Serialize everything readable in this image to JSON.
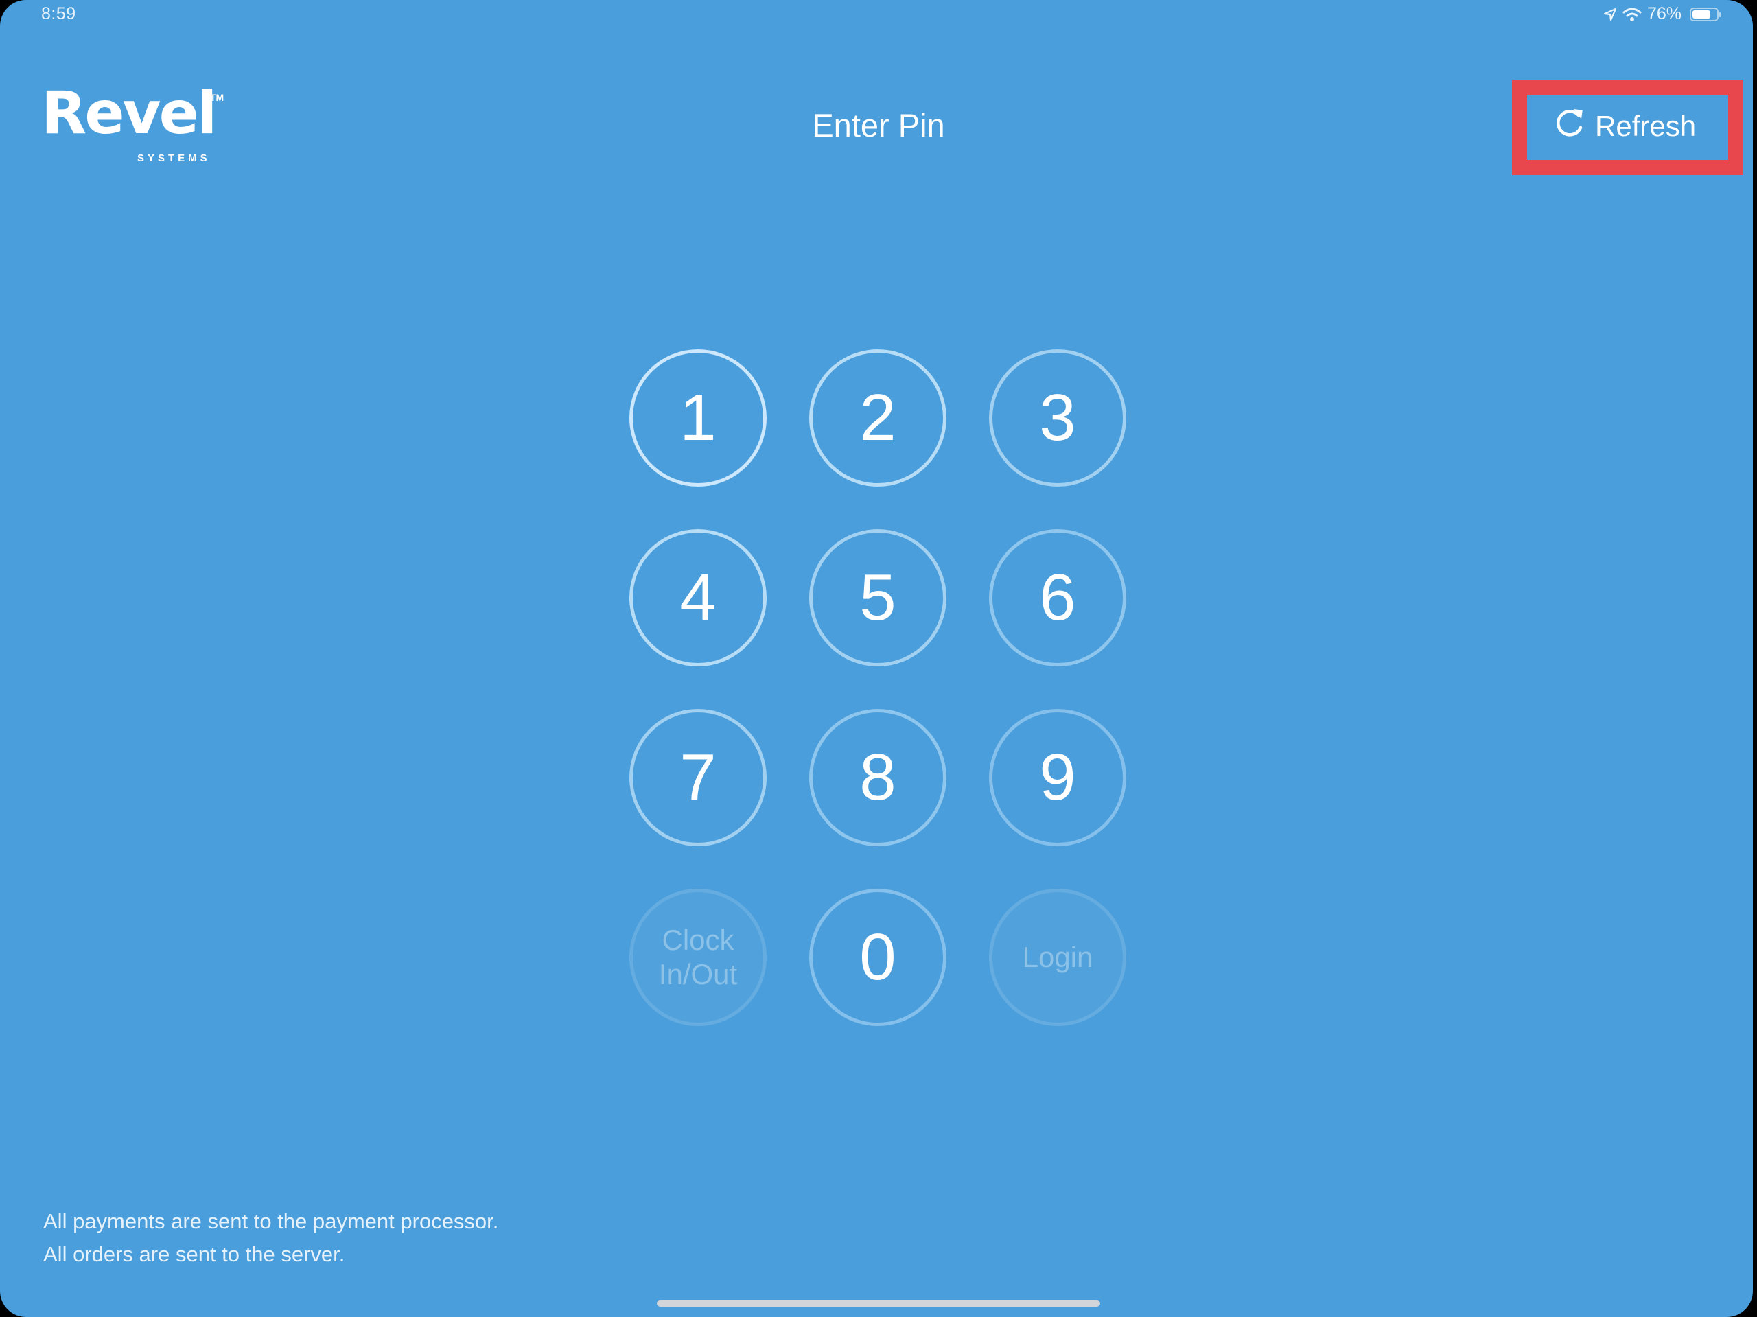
{
  "status_bar": {
    "time": "8:59",
    "icons": [
      "location-arrow-icon",
      "wifi-icon"
    ],
    "battery_percent_label": "76%",
    "battery_level": 0.76
  },
  "header": {
    "logo": {
      "word": "Revel",
      "trademark": "TM",
      "subtitle": "SYSTEMS"
    },
    "title": "Enter Pin",
    "refresh": {
      "label": "Refresh",
      "icon": "refresh-icon",
      "highlight_color": "#e8474e"
    }
  },
  "keypad": {
    "keys": [
      {
        "label": "1",
        "enabled": true
      },
      {
        "label": "2",
        "enabled": true
      },
      {
        "label": "3",
        "enabled": true
      },
      {
        "label": "4",
        "enabled": true
      },
      {
        "label": "5",
        "enabled": true
      },
      {
        "label": "6",
        "enabled": true
      },
      {
        "label": "7",
        "enabled": true
      },
      {
        "label": "8",
        "enabled": true
      },
      {
        "label": "9",
        "enabled": true
      },
      {
        "label_line1": "Clock",
        "label_line2": "In/Out",
        "enabled": false
      },
      {
        "label": "0",
        "enabled": true
      },
      {
        "label": "Login",
        "enabled": false
      }
    ]
  },
  "footer": {
    "lines": [
      "All payments are sent to the payment processor.",
      "All orders are sent to the server."
    ]
  },
  "colors": {
    "background": "#4a9edb",
    "text": "#ffffff",
    "highlight": "#e8474e"
  }
}
